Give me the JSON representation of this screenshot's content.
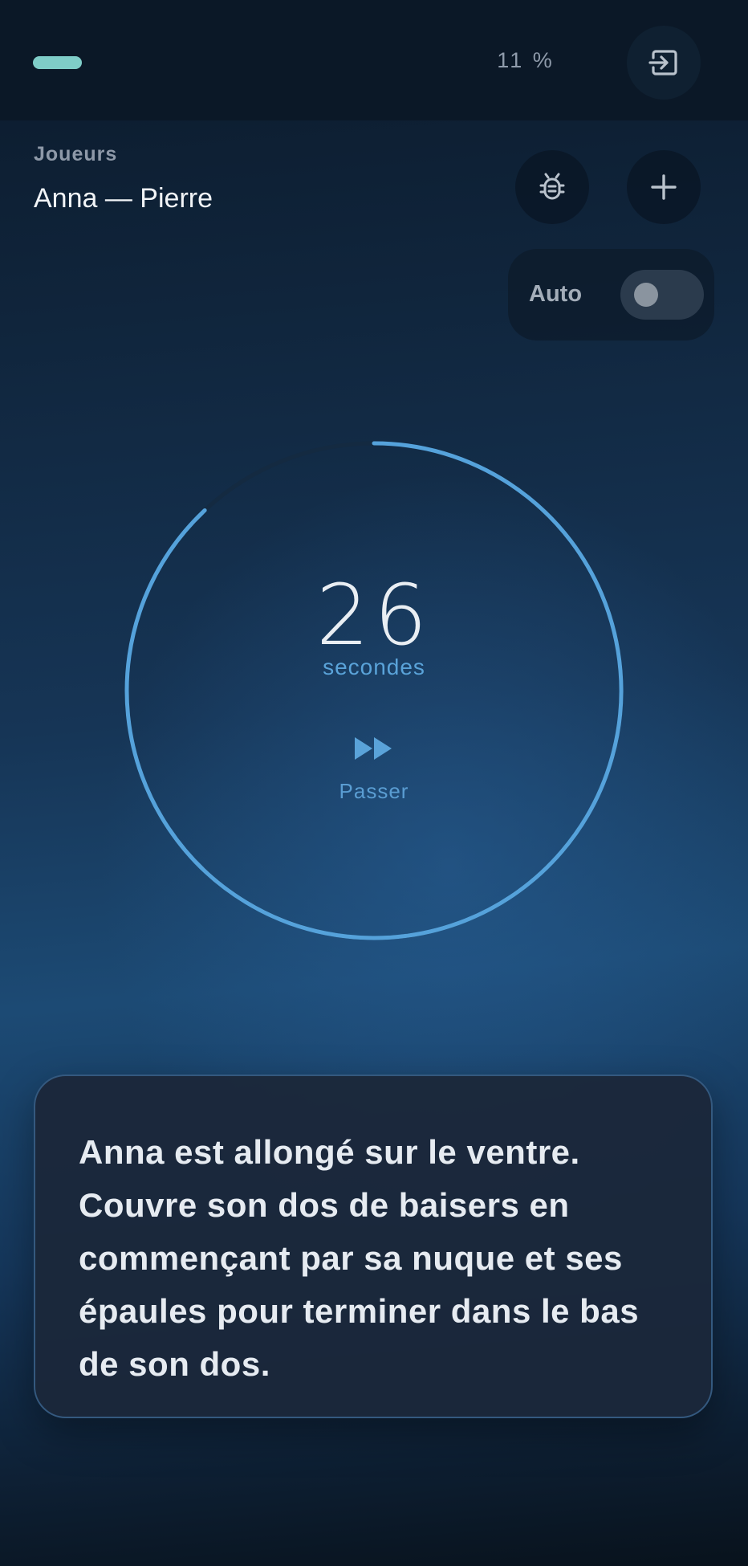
{
  "header": {
    "progress_percent": 11,
    "percent_text": "11 %",
    "exit_icon": "exit-icon"
  },
  "players": {
    "label": "Joueurs",
    "names": "Anna — Pierre"
  },
  "toolbar": {
    "bug_icon": "bug-icon",
    "add_icon": "plus-icon"
  },
  "auto": {
    "label": "Auto",
    "enabled": false
  },
  "timer": {
    "value": "26",
    "unit": "secondes",
    "remaining_fraction": 0.88,
    "skip_label": "Passer",
    "skip_icon": "fast-forward-icon"
  },
  "card": {
    "text": "Anna est allongé sur le ventre. Couvre son dos de baisers en commençant par sa nuque et ses épaules pour terminer dans le bas de son dos."
  },
  "colors": {
    "accent_teal": "#7fcdc8",
    "timer_blue": "#5aa3d9",
    "card_border": "#34597f"
  }
}
